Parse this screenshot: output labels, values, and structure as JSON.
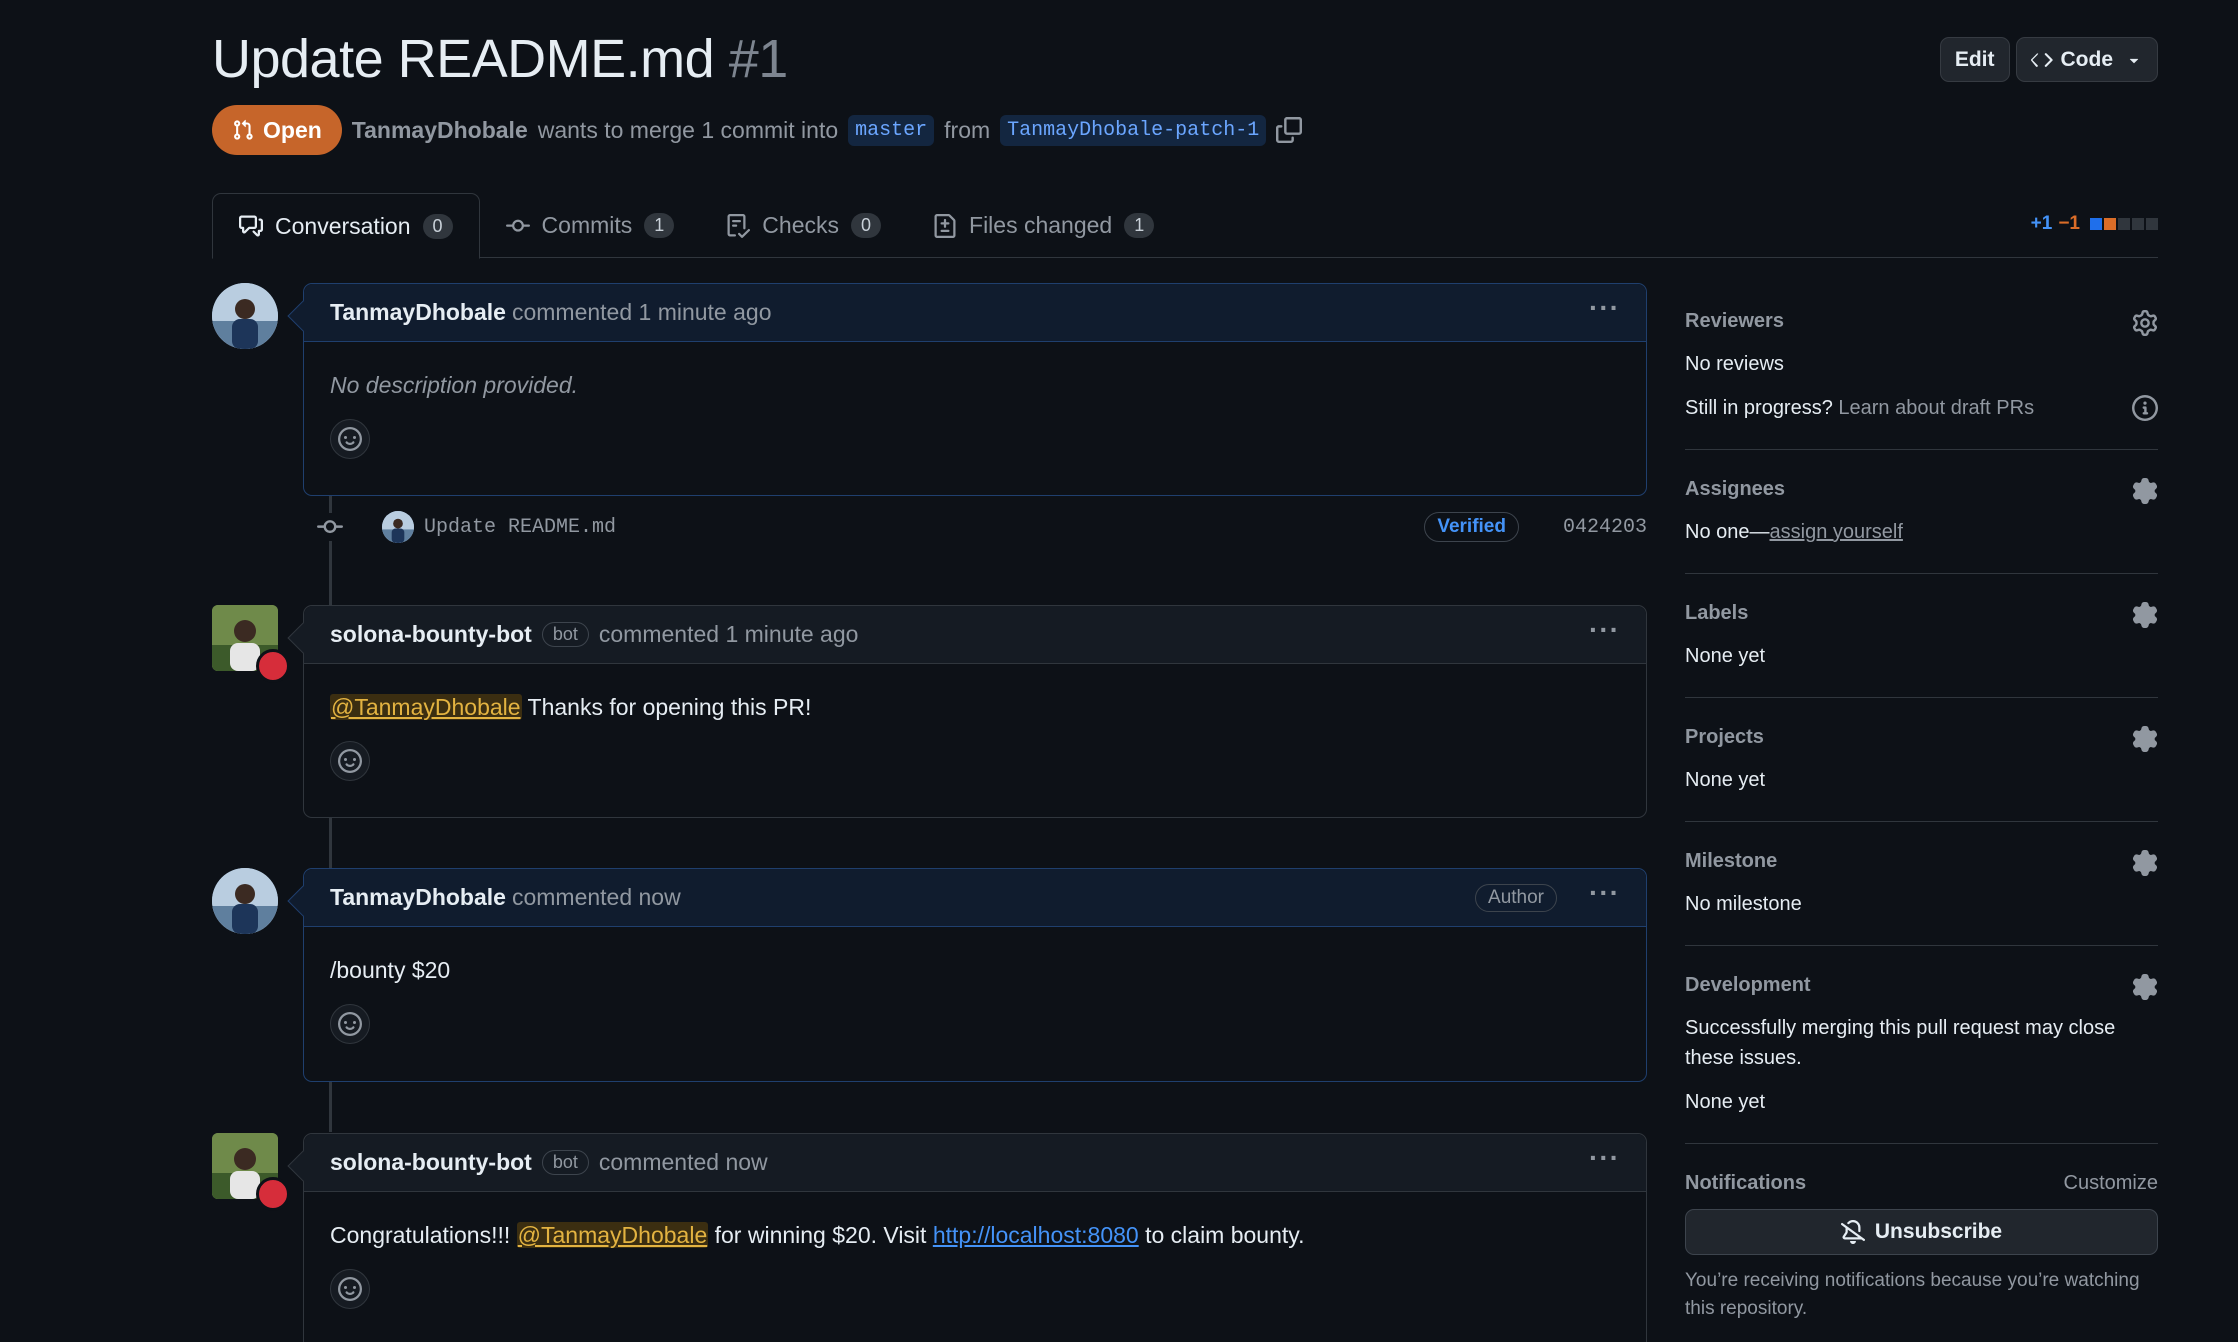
{
  "header": {
    "title": "Update README.md",
    "number": "#1",
    "edit_label": "Edit",
    "code_label": "Code"
  },
  "meta": {
    "state": "Open",
    "author": "TanmayDhobale",
    "text_mid": "wants to merge 1 commit into",
    "base_branch": "master",
    "from_text": "from",
    "head_branch": "TanmayDhobale-patch-1"
  },
  "tabs": [
    {
      "label": "Conversation",
      "count": "0"
    },
    {
      "label": "Commits",
      "count": "1"
    },
    {
      "label": "Checks",
      "count": "0"
    },
    {
      "label": "Files changed",
      "count": "1"
    }
  ],
  "diffstat": {
    "additions": "+1",
    "deletions": "−1"
  },
  "comments": [
    {
      "author": "TanmayDhobale",
      "action": "commented 1 minute ago",
      "body": "No description provided."
    },
    {
      "author": "solona-bounty-bot",
      "badge": "bot",
      "action": "commented 1 minute ago",
      "mention": "@TanmayDhobale",
      "body": "Thanks for opening this PR!"
    },
    {
      "author": "TanmayDhobale",
      "action": "commented now",
      "role": "Author",
      "body": "/bounty $20"
    },
    {
      "author": "solona-bounty-bot",
      "badge": "bot",
      "action": "commented now",
      "body_pre": "Congratulations!!!",
      "mention": "@TanmayDhobale",
      "body_mid": "for winning $20. Visit",
      "link": "http://localhost:8080",
      "body_post": "to claim bounty."
    }
  ],
  "commit": {
    "message": "Update README.md",
    "verified": "Verified",
    "sha": "0424203"
  },
  "sidebar": {
    "reviewers": {
      "title": "Reviewers",
      "value": "No reviews",
      "draft_q": "Still in progress?",
      "draft_link": "Learn about draft PRs"
    },
    "assignees": {
      "title": "Assignees",
      "value": "No one—",
      "link": "assign yourself"
    },
    "labels": {
      "title": "Labels",
      "value": "None yet"
    },
    "projects": {
      "title": "Projects",
      "value": "None yet"
    },
    "milestone": {
      "title": "Milestone",
      "value": "No milestone"
    },
    "development": {
      "title": "Development",
      "desc": "Successfully merging this pull request may close these issues.",
      "value": "None yet"
    },
    "notifications": {
      "title": "Notifications",
      "customize": "Customize",
      "button": "Unsubscribe",
      "desc": "You’re receiving notifications because you’re watching this repository."
    }
  }
}
